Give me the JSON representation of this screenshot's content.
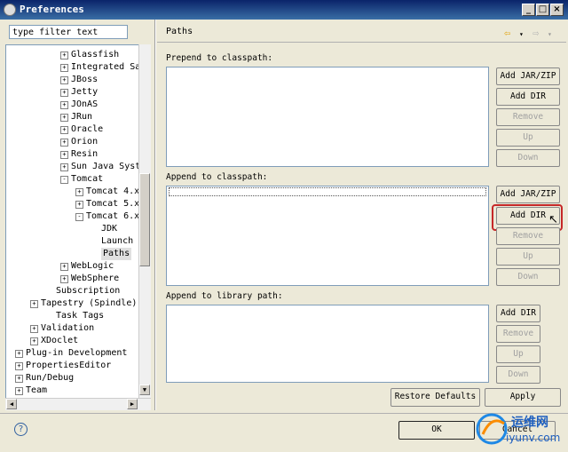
{
  "window": {
    "title": "Preferences"
  },
  "filter": {
    "value": "type filter text"
  },
  "tree": [
    {
      "label": "Glassfish",
      "indent": 3,
      "expander": "+"
    },
    {
      "label": "Integrated Sandb",
      "indent": 3,
      "expander": "+"
    },
    {
      "label": "JBoss",
      "indent": 3,
      "expander": "+"
    },
    {
      "label": "Jetty",
      "indent": 3,
      "expander": "+"
    },
    {
      "label": "JOnAS",
      "indent": 3,
      "expander": "+"
    },
    {
      "label": "JRun",
      "indent": 3,
      "expander": "+"
    },
    {
      "label": "Oracle",
      "indent": 3,
      "expander": "+"
    },
    {
      "label": "Orion",
      "indent": 3,
      "expander": "+"
    },
    {
      "label": "Resin",
      "indent": 3,
      "expander": "+"
    },
    {
      "label": "Sun Java System",
      "indent": 3,
      "expander": "+"
    },
    {
      "label": "Tomcat",
      "indent": 3,
      "expander": "-"
    },
    {
      "label": "Tomcat  4.x",
      "indent": 4,
      "expander": "+"
    },
    {
      "label": "Tomcat  5.x",
      "indent": 4,
      "expander": "+"
    },
    {
      "label": "Tomcat  6.x",
      "indent": 4,
      "expander": "-"
    },
    {
      "label": "JDK",
      "indent": 5,
      "expander": ""
    },
    {
      "label": "Launch",
      "indent": 5,
      "expander": ""
    },
    {
      "label": "Paths",
      "indent": 5,
      "expander": "",
      "selected": true
    },
    {
      "label": "WebLogic",
      "indent": 3,
      "expander": "+"
    },
    {
      "label": "WebSphere",
      "indent": 3,
      "expander": "+"
    },
    {
      "label": "Subscription",
      "indent": 2,
      "expander": ""
    },
    {
      "label": "Tapestry (Spindle)",
      "indent": 1,
      "expander": "+"
    },
    {
      "label": "Task Tags",
      "indent": 2,
      "expander": ""
    },
    {
      "label": "Validation",
      "indent": 1,
      "expander": "+"
    },
    {
      "label": "XDoclet",
      "indent": 1,
      "expander": "+"
    },
    {
      "label": "Plug-in Development",
      "indent": 0,
      "expander": "+"
    },
    {
      "label": "PropertiesEditor",
      "indent": 0,
      "expander": "+"
    },
    {
      "label": "Run/Debug",
      "indent": 0,
      "expander": "+"
    },
    {
      "label": "Team",
      "indent": 0,
      "expander": "+"
    }
  ],
  "page": {
    "title": "Paths"
  },
  "sections": {
    "prepend": {
      "label": "Prepend to classpath:",
      "add_jar": "Add JAR/ZIP",
      "add_dir": "Add DIR",
      "remove": "Remove",
      "up": "Up",
      "down": "Down"
    },
    "append": {
      "label": "Append to classpath:",
      "add_jar": "Add JAR/ZIP",
      "add_dir": "Add DIR",
      "remove": "Remove",
      "up": "Up",
      "down": "Down"
    },
    "library": {
      "label": "Append to library path:",
      "add_dir": "Add DIR",
      "remove": "Remove",
      "up": "Up",
      "down": "Down"
    }
  },
  "buttons": {
    "restore_defaults": "Restore Defaults",
    "apply": "Apply",
    "ok": "OK",
    "cancel": "Cancel"
  },
  "watermark": {
    "cn": "运维网",
    "url": "iyunv.com"
  }
}
